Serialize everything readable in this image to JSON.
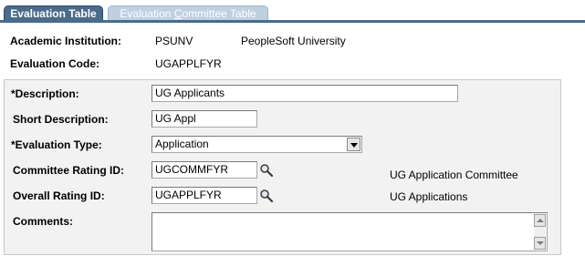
{
  "tabs": [
    {
      "label": "Evaluation Table",
      "active": true
    },
    {
      "label_pre": "Evaluation ",
      "label_accel": "C",
      "label_post": "ommittee Table",
      "active": false
    }
  ],
  "header": {
    "institution_label": "Academic Institution:",
    "institution_code": "PSUNV",
    "institution_name": "PeopleSoft University",
    "eval_code_label": "Evaluation Code:",
    "eval_code_value": "UGAPPLFYR"
  },
  "form": {
    "description_label": "*Description:",
    "description_value": "UG Applicants",
    "short_desc_label": "Short Description:",
    "short_desc_value": "UG Appl",
    "eval_type_label": "*Evaluation Type:",
    "eval_type_value": "Application",
    "committee_rating_label": "Committee Rating ID:",
    "committee_rating_value": "UGCOMMFYR",
    "committee_rating_desc": "UG Application Committee",
    "overall_rating_label": "Overall Rating ID:",
    "overall_rating_value": "UGAPPLFYR",
    "overall_rating_desc": "UG Applications",
    "comments_label": "Comments:",
    "comments_value": ""
  },
  "icons": {
    "lookup": "magnifier-icon",
    "dropdown": "chevron-down-icon",
    "scroll_up": "arrow-up-icon",
    "scroll_down": "arrow-down-icon"
  },
  "colors": {
    "active_tab": "#4a6b8c",
    "inactive_tab": "#bfd0e3",
    "panel_bg": "#f2f2f2"
  }
}
